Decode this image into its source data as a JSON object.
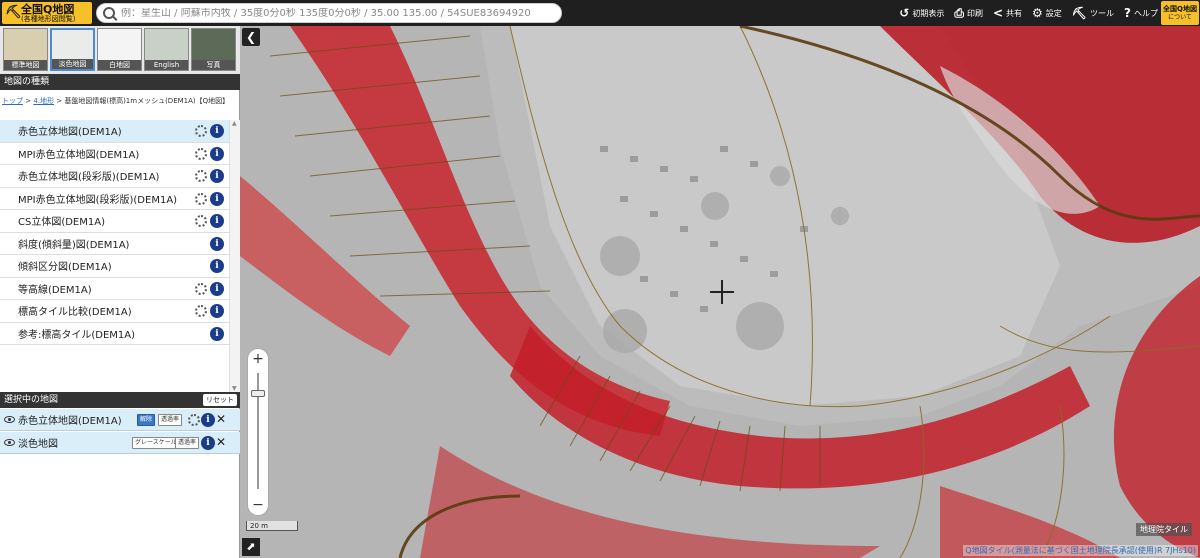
{
  "header": {
    "logo_title": "全国Q地図",
    "logo_sub": "(各種地形図閲覧)",
    "search_placeholder": "例：星生山 / 阿蘇市内牧 / 35度0分0秒 135度0分0秒 / 35.00 135.00 / 54SUE83694920",
    "tools": [
      {
        "icon": "↺",
        "label": "初期表示"
      },
      {
        "icon": "⎙",
        "label": "印刷"
      },
      {
        "icon": "<",
        "label": "共有"
      },
      {
        "icon": "⚙",
        "label": "設定"
      },
      {
        "icon": "⛏",
        "label": "ツール"
      },
      {
        "icon": "?",
        "label": "ヘルプ"
      }
    ],
    "about_title": "全国Q地図",
    "about_sub": "について"
  },
  "basemaps": [
    {
      "label": "標準地図",
      "color": "#d8cfb0"
    },
    {
      "label": "淡色地図",
      "color": "#e9ece8"
    },
    {
      "label": "白地図",
      "color": "#f4f4f4"
    },
    {
      "label": "English",
      "color": "#c8d0c8"
    },
    {
      "label": "写真",
      "color": "#5d6a57"
    }
  ],
  "panel": {
    "maptype_title": "地図の種類",
    "breadcrumb_top": "トップ",
    "breadcrumb_2": "4.地形",
    "breadcrumb_rest": "基盤地図情報(標高)1mメッシュ(DEM1A)【Q地図】",
    "map_items": [
      {
        "label": "赤色立体地図(DEM1A)",
        "gear": true,
        "active": true
      },
      {
        "label": "MPI赤色立体地図(DEM1A)",
        "gear": true
      },
      {
        "label": "赤色立体地図(段彩版)(DEM1A)",
        "gear": true
      },
      {
        "label": "MPI赤色立体地図(段彩版)(DEM1A)",
        "gear": true
      },
      {
        "label": "CS立体図(DEM1A)",
        "gear": true
      },
      {
        "label": "斜度(傾斜量)図(DEM1A)",
        "gear": false
      },
      {
        "label": "傾斜区分図(DEM1A)",
        "gear": false
      },
      {
        "label": "等高線(DEM1A)",
        "gear": true
      },
      {
        "label": "標高タイル比較(DEM1A)",
        "gear": true
      },
      {
        "label": "参考:標高タイル(DEM1A)",
        "gear": false
      }
    ],
    "info_glyph": "i",
    "selected_title": "選択中の地図",
    "reset_label": "リセット",
    "selected": [
      {
        "label": "赤色立体地図(DEM1A)",
        "btn1": "解除",
        "btn2": "透過率"
      },
      {
        "label": "淡色地図",
        "btn1": "グレースケール",
        "btn2": "透過率"
      }
    ],
    "close_glyph": "✕"
  },
  "map": {
    "collapse_glyph": "❮",
    "zoom_in": "+",
    "zoom_out": "−",
    "zoom_level_fraction": 0.15,
    "scale_label": "20 m",
    "attribution": "地理院タイル",
    "credit": "Q地図タイル(測量法に基づく国土地理院長承認(使用)R 7JHs10)",
    "expand_glyph": "⬈"
  }
}
